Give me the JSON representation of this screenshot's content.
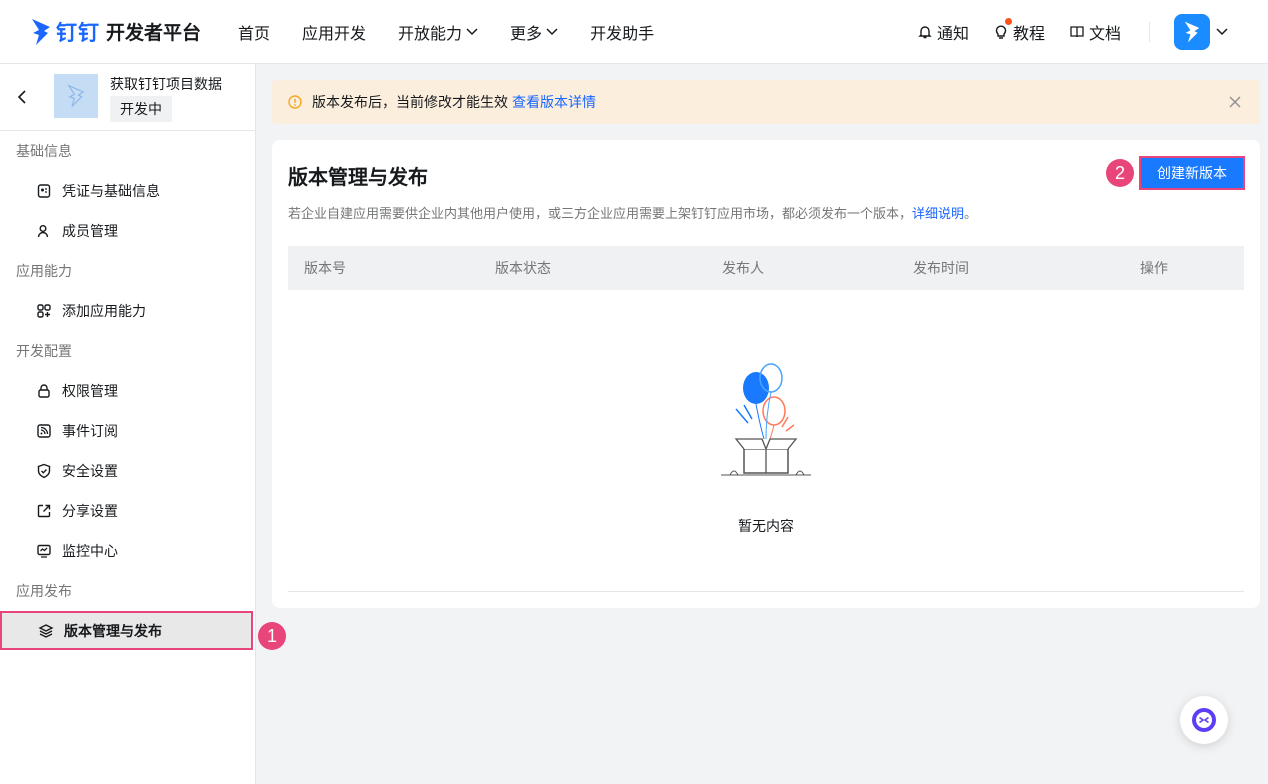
{
  "header": {
    "brand_ding": "钉钉",
    "brand_platform": "开发者平台",
    "nav": [
      {
        "label": "首页"
      },
      {
        "label": "应用开发"
      },
      {
        "label": "开放能力"
      },
      {
        "label": "更多"
      },
      {
        "label": "开发助手"
      }
    ],
    "tools": {
      "notify": "通知",
      "tutorial": "教程",
      "docs": "文档"
    }
  },
  "sidebar": {
    "app_name": "获取钉钉项目数据",
    "app_status": "开发中",
    "groups": [
      {
        "title": "基础信息",
        "items": [
          {
            "label": "凭证与基础信息"
          },
          {
            "label": "成员管理"
          }
        ]
      },
      {
        "title": "应用能力",
        "items": [
          {
            "label": "添加应用能力"
          }
        ]
      },
      {
        "title": "开发配置",
        "items": [
          {
            "label": "权限管理"
          },
          {
            "label": "事件订阅"
          },
          {
            "label": "安全设置"
          },
          {
            "label": "分享设置"
          },
          {
            "label": "监控中心"
          }
        ]
      },
      {
        "title": "应用发布",
        "items": [
          {
            "label": "版本管理与发布"
          }
        ]
      }
    ]
  },
  "markers": {
    "one": "1",
    "two": "2"
  },
  "alert": {
    "text": "版本发布后，当前修改才能生效",
    "link": "查看版本详情"
  },
  "card": {
    "title": "版本管理与发布",
    "create_button": "创建新版本",
    "description": "若企业自建应用需要供企业内其他用户使用，或三方企业应用需要上架钉钉应用市场，都必须发布一个版本，",
    "description_link": "详细说明",
    "description_end": "。",
    "columns": [
      "版本号",
      "版本状态",
      "发布人",
      "发布时间",
      "操作"
    ],
    "empty_text": "暂无内容"
  },
  "colors": {
    "accent": "#1a66ff",
    "marker": "#e8457a",
    "alert_bg": "#fbeedd"
  }
}
